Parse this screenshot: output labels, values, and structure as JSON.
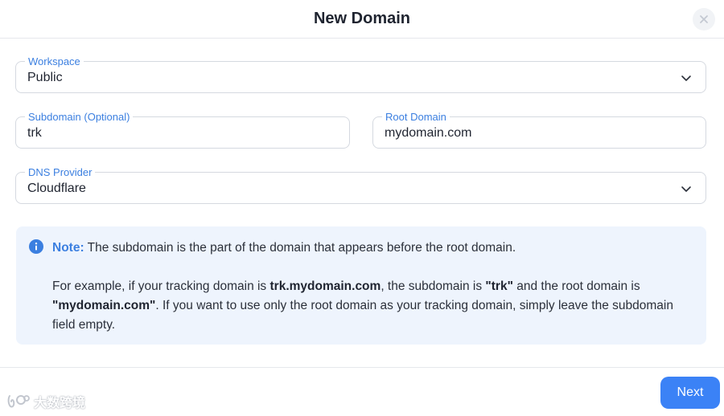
{
  "dialog": {
    "title": "New Domain",
    "close_icon": "close-icon"
  },
  "form": {
    "workspace": {
      "label": "Workspace",
      "value": "Public",
      "icon": "chevron-down-icon"
    },
    "subdomain": {
      "label": "Subdomain (Optional)",
      "value": "trk"
    },
    "root_domain": {
      "label": "Root Domain",
      "value": "mydomain.com"
    },
    "dns_provider": {
      "label": "DNS Provider",
      "value": "Cloudflare",
      "icon": "chevron-down-icon"
    }
  },
  "note": {
    "icon": "info-icon",
    "label": "Note:",
    "text": " The subdomain is the part of the domain that appears before the root domain.",
    "example_1": "For example, if your tracking domain is ",
    "example_domain": "trk.mydomain.com",
    "example_2": ", the subdomain is ",
    "example_sub": "\"trk\"",
    "example_3": " and the root domain is ",
    "example_root": "\"mydomain.com\"",
    "example_4": ". If you want to use only the root domain as your tracking domain, simply leave the subdomain field empty."
  },
  "footer": {
    "next_label": "Next"
  },
  "watermark": {
    "text": "大数跨境"
  },
  "colors": {
    "accent": "#3b82f6",
    "label_blue": "#3b7fe0",
    "note_bg": "#eef4fd"
  }
}
